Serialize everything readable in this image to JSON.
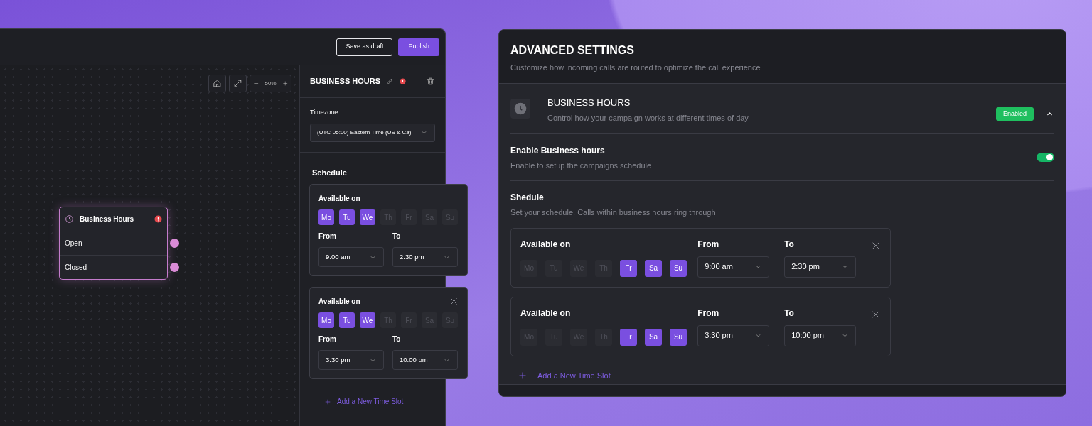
{
  "editor": {
    "buttons": [
      {
        "label": "Save as draft",
        "kind": "outline"
      },
      {
        "label": "Publish",
        "kind": "primary"
      }
    ],
    "zoom": {
      "reading": "50%"
    },
    "node": {
      "title": "Business Hours",
      "outputs": [
        "Open",
        "Closed"
      ]
    },
    "panel": {
      "title": "BUSINESS HOURS",
      "timezone_label": "Timezone",
      "timezone": "(UTC-05:00) Eastern Time (US & Ca)",
      "schedule_title": "Schedule",
      "add_label": "Add a New Time Slot",
      "slots": [
        {
          "label": "Available on",
          "removable": false,
          "from_label": "From",
          "from": "9:00 am",
          "to_label": "To",
          "to": "2:30 pm",
          "days": [
            {
              "label": "Mo",
              "selected": true
            },
            {
              "label": "Tu",
              "selected": true
            },
            {
              "label": "We",
              "selected": true
            },
            {
              "label": "Th",
              "selected": false
            },
            {
              "label": "Fr",
              "selected": false
            },
            {
              "label": "Sa",
              "selected": false
            },
            {
              "label": "Su",
              "selected": false
            }
          ]
        },
        {
          "label": "Available on",
          "removable": true,
          "from_label": "From",
          "from": "3:30 pm",
          "to_label": "To",
          "to": "10:00 pm",
          "days": [
            {
              "label": "Mo",
              "selected": true
            },
            {
              "label": "Tu",
              "selected": true
            },
            {
              "label": "We",
              "selected": true
            },
            {
              "label": "Th",
              "selected": false
            },
            {
              "label": "Fr",
              "selected": false
            },
            {
              "label": "Sa",
              "selected": false
            },
            {
              "label": "Su",
              "selected": false
            }
          ]
        }
      ]
    }
  },
  "settings": {
    "title": "ADVANCED SETTINGS",
    "subtitle": "Customize how incoming calls are routed to optimize the call experience",
    "section": {
      "title": "BUSINESS HOURS",
      "subtitle": "Control how your campaign works at different times of day",
      "badge": "Enabled",
      "expanded": true
    },
    "enable": {
      "title": "Enable Business hours",
      "subtitle": "Enable to setup the campaigns schedule",
      "on": true
    },
    "schedule": {
      "title": "Shedule",
      "subtitle": "Set your schedule. Calls within business hours ring through"
    },
    "add_label": "Add a New Time Slot",
    "slots": [
      {
        "label": "Available on",
        "removable": true,
        "from_label": "From",
        "from": "9:00 am",
        "to_label": "To",
        "to": "2:30 pm",
        "days": [
          {
            "label": "Mo",
            "selected": false
          },
          {
            "label": "Tu",
            "selected": false
          },
          {
            "label": "We",
            "selected": false
          },
          {
            "label": "Th",
            "selected": false
          },
          {
            "label": "Fr",
            "selected": true
          },
          {
            "label": "Sa",
            "selected": true
          },
          {
            "label": "Su",
            "selected": true
          }
        ]
      },
      {
        "label": "Available on",
        "removable": true,
        "from_label": "From",
        "from": "3:30 pm",
        "to_label": "To",
        "to": "10:00 pm",
        "days": [
          {
            "label": "Mo",
            "selected": false
          },
          {
            "label": "Tu",
            "selected": false
          },
          {
            "label": "We",
            "selected": false
          },
          {
            "label": "Th",
            "selected": false
          },
          {
            "label": "Fr",
            "selected": true
          },
          {
            "label": "Sa",
            "selected": true
          },
          {
            "label": "Su",
            "selected": true
          }
        ]
      }
    ]
  }
}
